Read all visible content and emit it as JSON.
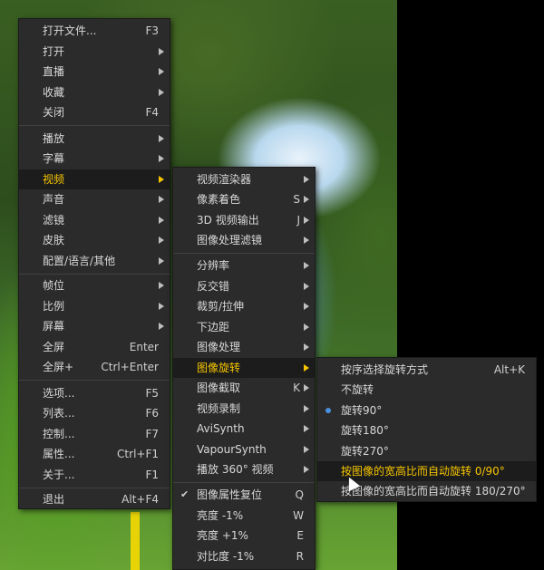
{
  "main_menu": {
    "items": [
      {
        "label": "打开文件...",
        "shortcut": "F3",
        "arrow": false
      },
      {
        "label": "打开",
        "shortcut": "",
        "arrow": true
      },
      {
        "label": "直播",
        "shortcut": "",
        "arrow": true
      },
      {
        "label": "收藏",
        "shortcut": "",
        "arrow": true
      },
      {
        "label": "关闭",
        "shortcut": "F4",
        "arrow": false
      },
      {
        "label": "播放",
        "shortcut": "",
        "arrow": true
      },
      {
        "label": "字幕",
        "shortcut": "",
        "arrow": true
      },
      {
        "label": "视频",
        "shortcut": "",
        "arrow": true
      },
      {
        "label": "声音",
        "shortcut": "",
        "arrow": true
      },
      {
        "label": "滤镜",
        "shortcut": "",
        "arrow": true
      },
      {
        "label": "皮肤",
        "shortcut": "",
        "arrow": true
      },
      {
        "label": "配置/语言/其他",
        "shortcut": "",
        "arrow": true
      },
      {
        "label": "帧位",
        "shortcut": "",
        "arrow": true
      },
      {
        "label": "比例",
        "shortcut": "",
        "arrow": true
      },
      {
        "label": "屏幕",
        "shortcut": "",
        "arrow": true
      },
      {
        "label": "全屏",
        "shortcut": "Enter",
        "arrow": false
      },
      {
        "label": "全屏+",
        "shortcut": "Ctrl+Enter",
        "arrow": false
      },
      {
        "label": "选项...",
        "shortcut": "F5",
        "arrow": false
      },
      {
        "label": "列表...",
        "shortcut": "F6",
        "arrow": false
      },
      {
        "label": "控制...",
        "shortcut": "F7",
        "arrow": false
      },
      {
        "label": "属性...",
        "shortcut": "Ctrl+F1",
        "arrow": false
      },
      {
        "label": "关于...",
        "shortcut": "F1",
        "arrow": false
      },
      {
        "label": "退出",
        "shortcut": "Alt+F4",
        "arrow": false
      }
    ]
  },
  "video_menu": {
    "items": [
      {
        "label": "视频渲染器",
        "shortcut": "",
        "arrow": true
      },
      {
        "label": "像素着色",
        "shortcut": "S",
        "arrow": true
      },
      {
        "label": "3D 视频输出",
        "shortcut": "J",
        "arrow": true
      },
      {
        "label": "图像处理滤镜",
        "shortcut": "",
        "arrow": true
      },
      {
        "label": "分辨率",
        "shortcut": "",
        "arrow": true
      },
      {
        "label": "反交错",
        "shortcut": "",
        "arrow": true
      },
      {
        "label": "裁剪/拉伸",
        "shortcut": "",
        "arrow": true
      },
      {
        "label": "下边距",
        "shortcut": "",
        "arrow": true
      },
      {
        "label": "图像处理",
        "shortcut": "",
        "arrow": true
      },
      {
        "label": "图像旋转",
        "shortcut": "",
        "arrow": true
      },
      {
        "label": "图像截取",
        "shortcut": "K",
        "arrow": true
      },
      {
        "label": "视频录制",
        "shortcut": "",
        "arrow": true
      },
      {
        "label": "AviSynth",
        "shortcut": "",
        "arrow": true
      },
      {
        "label": "VapourSynth",
        "shortcut": "",
        "arrow": true
      },
      {
        "label": "播放 360° 视频",
        "shortcut": "",
        "arrow": true
      },
      {
        "label": "图像属性复位",
        "shortcut": "Q",
        "arrow": false
      },
      {
        "label": "亮度 -1%",
        "shortcut": "W",
        "arrow": false
      },
      {
        "label": "亮度 +1%",
        "shortcut": "E",
        "arrow": false
      },
      {
        "label": "对比度 -1%",
        "shortcut": "R",
        "arrow": false
      }
    ]
  },
  "rotate_menu": {
    "items": [
      {
        "label": "按序选择旋转方式",
        "shortcut": "Alt+K"
      },
      {
        "label": "不旋转",
        "shortcut": ""
      },
      {
        "label": "旋转90°",
        "shortcut": ""
      },
      {
        "label": "旋转180°",
        "shortcut": ""
      },
      {
        "label": "旋转270°",
        "shortcut": ""
      },
      {
        "label": "按图像的宽高比而自动旋转 0/90°",
        "shortcut": ""
      },
      {
        "label": "按图像的宽高比而自动旋转 180/270°",
        "shortcut": ""
      }
    ]
  },
  "colors": {
    "menu_bg": "#2b2b2b",
    "highlight_text": "#f7c600",
    "radio_dot": "#4a8fe0"
  }
}
